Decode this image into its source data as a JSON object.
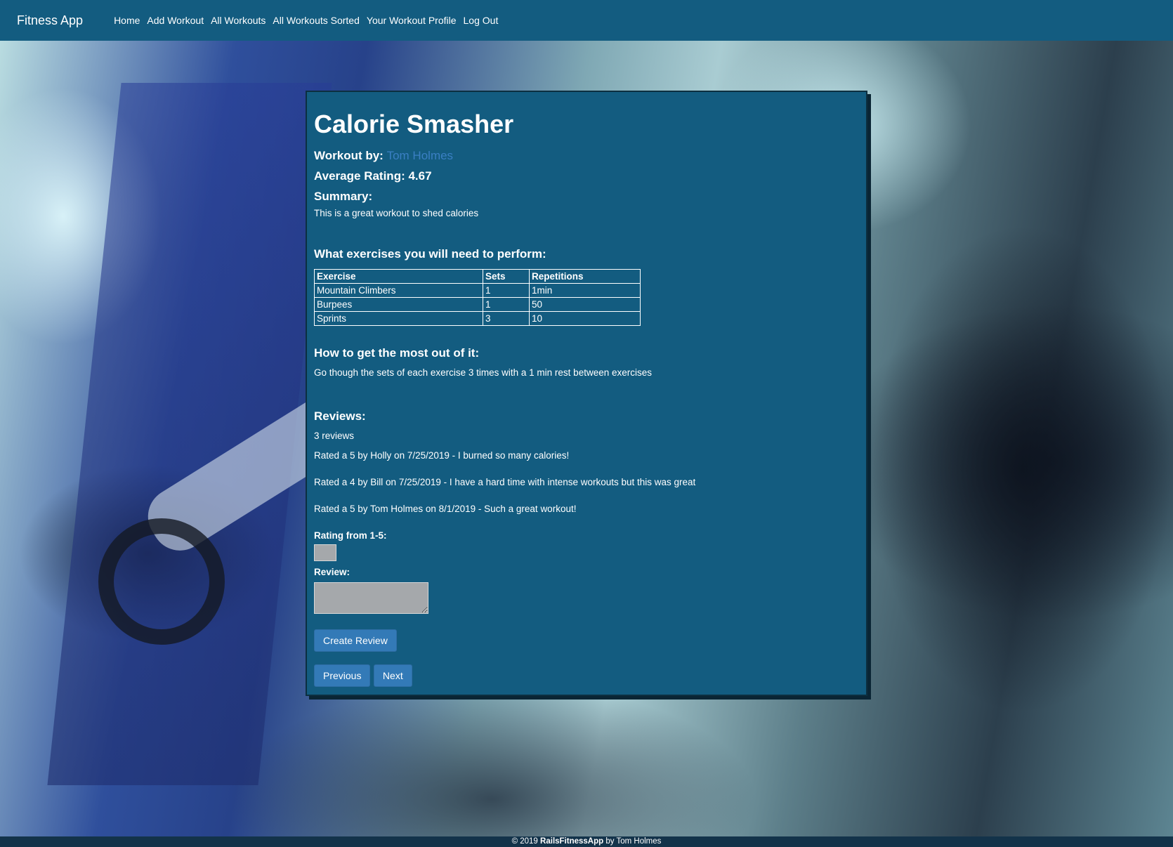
{
  "nav": {
    "brand": "Fitness App",
    "links": [
      "Home",
      "Add Workout",
      "All Workouts",
      "All Workouts Sorted",
      "Your Workout Profile",
      "Log Out"
    ]
  },
  "workout": {
    "title": "Calorie Smasher",
    "author_label": "Workout by:",
    "author": "Tom Holmes",
    "rating_label": "Average Rating:",
    "rating": "4.67",
    "summary_label": "Summary:",
    "summary": "This is a great workout to shed calories",
    "exercises_heading": "What exercises you will need to perform:",
    "table": {
      "headers": [
        "Exercise",
        "Sets",
        "Repetitions"
      ],
      "rows": [
        [
          "Mountain Climbers",
          "1",
          "1min"
        ],
        [
          "Burpees",
          "1",
          "50"
        ],
        [
          "Sprints",
          "3",
          "10"
        ]
      ]
    },
    "tips_heading": "How to get the most out of it:",
    "tips": "Go though the sets of each exercise 3 times with a 1 min rest between exercises"
  },
  "reviews": {
    "heading": "Reviews:",
    "count": "3 reviews",
    "items": [
      "Rated a 5 by Holly on 7/25/2019 - I burned so many calories!",
      "Rated a 4 by Bill on 7/25/2019 - I have a hard time with intense workouts but this was great",
      "Rated a 5 by Tom Holmes on 8/1/2019 - Such a great workout!"
    ]
  },
  "form": {
    "rating_label": "Rating from 1-5:",
    "review_label": "Review:",
    "submit_label": "Create Review"
  },
  "pager": {
    "previous": "Previous",
    "next": "Next"
  },
  "footer": {
    "prefix": "© 2019",
    "app": "RailsFitnessApp",
    "suffix": "by Tom Holmes"
  }
}
